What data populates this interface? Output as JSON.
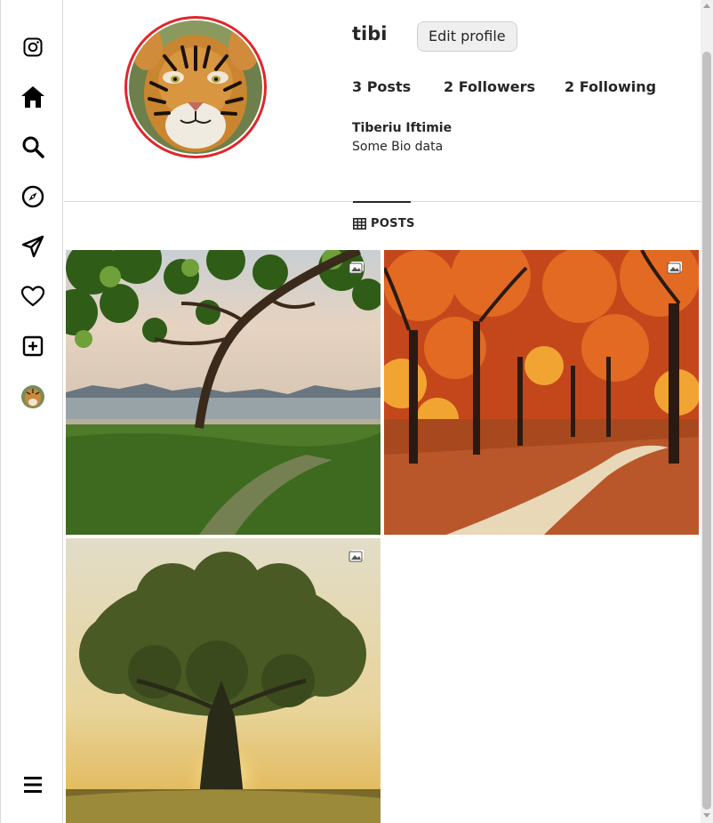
{
  "sidebar": {
    "items": [
      {
        "icon": "instagram-icon"
      },
      {
        "icon": "home-icon"
      },
      {
        "icon": "search-icon"
      },
      {
        "icon": "explore-compass-icon"
      },
      {
        "icon": "messages-send-icon"
      },
      {
        "icon": "notifications-heart-icon"
      },
      {
        "icon": "create-plus-icon"
      },
      {
        "icon": "profile-avatar"
      },
      {
        "icon": "menu-hamburger-icon"
      }
    ]
  },
  "profile": {
    "username": "tibi",
    "edit_button_label": "Edit profile",
    "stats": {
      "posts": "3 Posts",
      "followers": "2 Followers",
      "following": "2 Following"
    },
    "full_name": "Tiberiu Iftimie",
    "bio": "Some Bio data"
  },
  "tabs": {
    "posts_label": "POSTS"
  },
  "posts": [
    {
      "subject": "coastal tree landscape",
      "badge": "image-icon"
    },
    {
      "subject": "autumn forest path",
      "badge": "image-icon"
    },
    {
      "subject": "lone tree at sunset",
      "badge": "image-icon"
    }
  ],
  "colors": {
    "story_ring": "#e0262b",
    "border": "#dbdbdb",
    "button_bg": "#efefef"
  }
}
